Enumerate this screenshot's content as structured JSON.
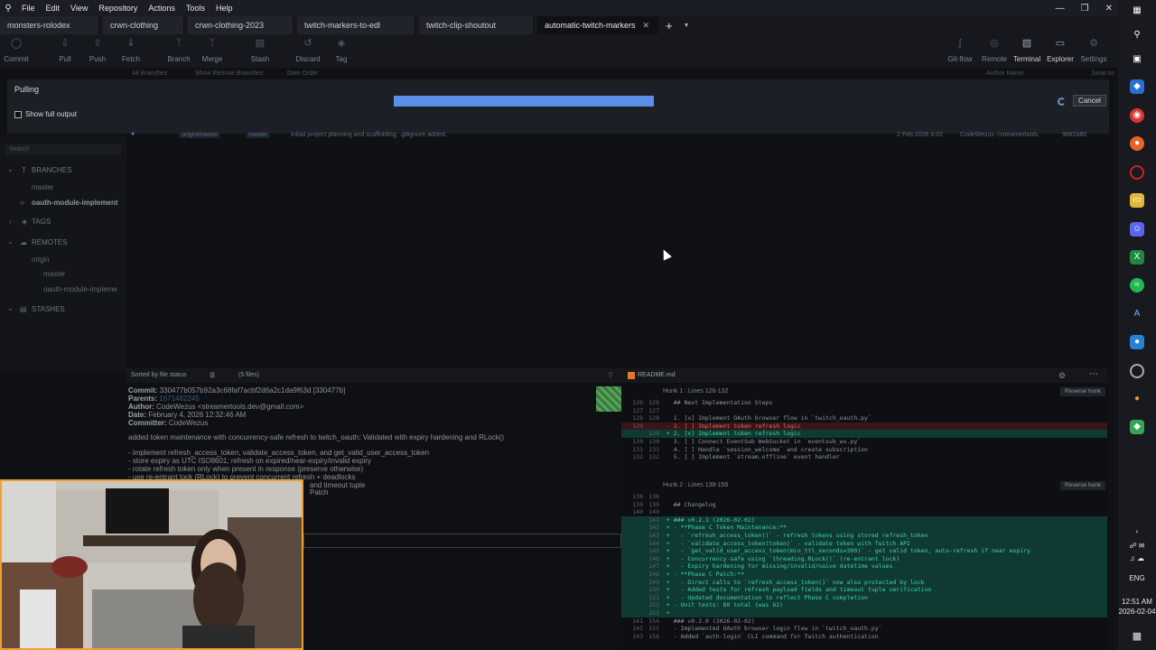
{
  "menu": [
    "File",
    "Edit",
    "View",
    "Repository",
    "Actions",
    "Tools",
    "Help"
  ],
  "tabs": [
    "monsters-rolodex",
    "crwn-clothing",
    "crwn-clothing-2023",
    "twitch-markers-to-edl",
    "twitch-clip-shoutout",
    "automatic-twitch-markers"
  ],
  "toolbar": {
    "left": [
      "Commit",
      "Pull",
      "Push",
      "Fetch",
      "Branch",
      "Merge",
      "Stash",
      "Discard",
      "Tag"
    ],
    "right": [
      "Git-flow",
      "Remote",
      "Terminal",
      "Explorer",
      "Settings"
    ]
  },
  "filter": {
    "all_branches": "All Branches",
    "show_remote": "Show Remote Branches",
    "date_order": "Date Order",
    "author_name": "Author Name",
    "jump_to": "Jump to:"
  },
  "pulling": {
    "title": "Pulling",
    "progress": 0.32,
    "cancel": "Cancel",
    "show_full_output": "Show full output"
  },
  "graph": {
    "ref1": "origin/master",
    "ref2": "master",
    "message": "Initial project planning and scaffolding, .gitignore added.",
    "date": "2 Feb 2026 6:02",
    "author": "CodeWezus <streamertools",
    "hash": "9681b80"
  },
  "sidebar": {
    "search": "Search",
    "branches": "BRANCHES",
    "master": "master",
    "oauth": "oauth-module-implement",
    "tags": "TAGS",
    "remotes": "REMOTES",
    "origin": "origin",
    "remote_master": "master",
    "remote_oauth": "oauth-module-impleme",
    "stashes": "STASHES"
  },
  "filelist": {
    "sort": "Sorted by file status",
    "count": "(5 files)"
  },
  "commit": {
    "commit_label": "Commit:",
    "commit_value": "330477b057b92a3c68faf7acbf2d6a2c1da9f63d [330477b]",
    "parents_label": "Parents:",
    "parents_value": "1671462245",
    "author_label": "Author:",
    "author_value": "CodeWezus <streamertools.dev@gmail.com>",
    "date_label": "Date:",
    "date_value": "February 4, 2026 12:32:46 AM",
    "committer_label": "Committer:",
    "committer_value": "CodeWezus",
    "summary": "added token maintenance with concurrency-safe refresh to twitch_oauth; Validated with expiry hardening and RLock()",
    "bullets": [
      "- implement refresh_access_token, validate_access_token, and get_valid_user_access_token",
      "- store expiry as UTC ISO8601; refresh on expired/near-expiry/invalid expiry",
      "- rotate refresh token only when present in response (preserve otherwise)",
      "- use re-entrant lock (RLock) to prevent concurrent refresh + deadlocks"
    ],
    "partial1": "and timeout tuple",
    "partial2": "Patch"
  },
  "diff": {
    "filename": "README.md",
    "hunk1": "Hunk 1 : Lines 126-132",
    "hunk2": "Hunk 2 : Lines 138-156",
    "reverse": "Reverse hunk",
    "lines1": [
      {
        "a": "126",
        "b": "126",
        "t": "   ## Next Implementation Steps",
        "k": ""
      },
      {
        "a": "127",
        "b": "127",
        "t": "",
        "k": ""
      },
      {
        "a": "128",
        "b": "128",
        "t": "   1. [x] Implement OAuth browser flow in `twitch_oauth.py`",
        "k": ""
      },
      {
        "a": "129",
        "b": "",
        "t": " - 2. [ ] Implement token refresh logic",
        "k": "del"
      },
      {
        "a": "",
        "b": "129",
        "t": " + 2. [x] Implement token refresh logic",
        "k": "add"
      },
      {
        "a": "130",
        "b": "130",
        "t": "   3. [ ] Connect EventSub WebSocket in `eventsub_ws.py`",
        "k": ""
      },
      {
        "a": "131",
        "b": "131",
        "t": "   4. [ ] Handle `session_welcome` and create subscription",
        "k": ""
      },
      {
        "a": "132",
        "b": "132",
        "t": "   5. [ ] Implement `stream.offline` event handler",
        "k": ""
      }
    ],
    "lines2": [
      {
        "a": "138",
        "b": "138",
        "t": "",
        "k": ""
      },
      {
        "a": "139",
        "b": "139",
        "t": "   ## Changelog",
        "k": ""
      },
      {
        "a": "140",
        "b": "140",
        "t": "",
        "k": ""
      },
      {
        "a": "",
        "b": "141",
        "t": " + ### v0.2.1 (2026-02-02)",
        "k": "add"
      },
      {
        "a": "",
        "b": "142",
        "t": " + - **Phase C Token Maintenance:**",
        "k": "add"
      },
      {
        "a": "",
        "b": "143",
        "t": " +   - `refresh_access_token()` - refresh tokens using stored refresh_token",
        "k": "add"
      },
      {
        "a": "",
        "b": "144",
        "t": " +   - `validate_access_token(token)` - validate token with Twitch API",
        "k": "add"
      },
      {
        "a": "",
        "b": "145",
        "t": " +   - `get_valid_user_access_token(min_ttl_seconds=300)` - get valid token, auto-refresh if near expiry",
        "k": "add"
      },
      {
        "a": "",
        "b": "146",
        "t": " +   - Concurrency-safe using `threading.RLock()` (re-entrant lock)",
        "k": "add"
      },
      {
        "a": "",
        "b": "147",
        "t": " +   - Expiry hardening for missing/invalid/naive datetime values",
        "k": "add"
      },
      {
        "a": "",
        "b": "148",
        "t": " + - **Phase C Patch:**",
        "k": "add"
      },
      {
        "a": "",
        "b": "149",
        "t": " +   - Direct calls to `refresh_access_token()` now also protected by lock",
        "k": "add"
      },
      {
        "a": "",
        "b": "150",
        "t": " +   - Added tests for refresh payload fields and timeout tuple verification",
        "k": "add"
      },
      {
        "a": "",
        "b": "151",
        "t": " +   - Updated documentation to reflect Phase C completion",
        "k": "add"
      },
      {
        "a": "",
        "b": "152",
        "t": " + - Unit tests: 80 total (was 62)",
        "k": "add"
      },
      {
        "a": "",
        "b": "153",
        "t": " +",
        "k": "add"
      },
      {
        "a": "141",
        "b": "154",
        "t": "   ### v0.2.0 (2026-02-02)",
        "k": ""
      },
      {
        "a": "142",
        "b": "155",
        "t": "   - Implemented OAuth browser login flow in `twitch_oauth.py`",
        "k": ""
      },
      {
        "a": "143",
        "b": "156",
        "t": "   - Added `auth-login` CLI command for Twitch authentication",
        "k": ""
      }
    ]
  },
  "tray": {
    "lang": "ENG",
    "time": "12:51 AM",
    "date": "2026-02-04"
  }
}
